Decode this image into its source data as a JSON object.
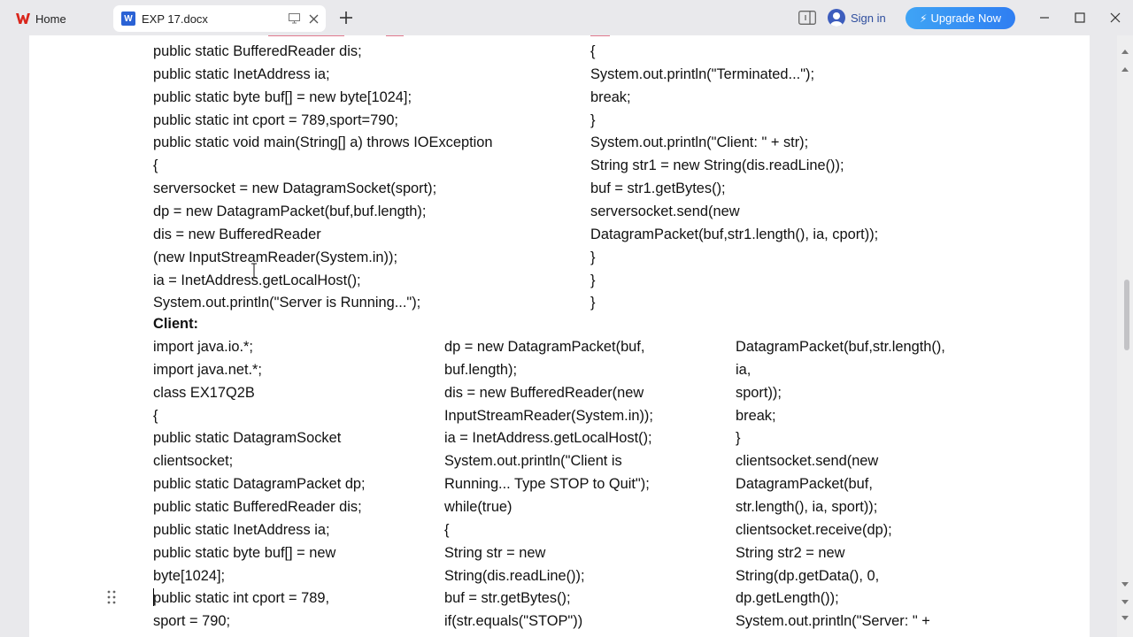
{
  "titlebar": {
    "home_tab_label": "Home",
    "doc_tab_title": "EXP 17.docx",
    "doc_logo_letter": "W",
    "signin_label": "Sign in",
    "upgrade_label": "Upgrade Now",
    "brand_color": "#d9261c",
    "upgrade_color": "#2f7ef2"
  },
  "icons": {
    "home": "wps-logo-icon",
    "doc": "word-doc-icon",
    "monitor": "monitor-icon",
    "close_tab": "close-icon",
    "new_tab": "plus-icon",
    "layout": "layout-icon",
    "user": "user-icon",
    "bolt": "bolt-icon",
    "minimize": "minimize-icon",
    "maximize": "maximize-icon",
    "close_window": "close-window-icon"
  },
  "document": {
    "server_left": [
      "public static BufferedReader dis;",
      "public static InetAddress ia;",
      "public static byte buf[] = new byte[1024];",
      "public static int cport = 789,sport=790;",
      "public static void main(String[] a) throws IOException",
      "{",
      "serversocket = new DatagramSocket(sport);",
      "dp = new DatagramPacket(buf,buf.length);",
      "dis = new BufferedReader",
      "(new InputStreamReader(System.in));",
      "ia = InetAddress.getLocalHost();",
      "System.out.println(\"Server is Running...\");"
    ],
    "server_right": [
      "{",
      "System.out.println(\"Terminated...\");",
      "break;",
      "}",
      "System.out.println(\"Client: \" + str);",
      "String str1 = new String(dis.readLine());",
      "buf = str1.getBytes();",
      "serversocket.send(new",
      "DatagramPacket(buf,str1.length(), ia, cport));",
      "}",
      "}",
      "}"
    ],
    "client_heading": "Client:",
    "client_col1": [
      "import java.io.*;",
      "import java.net.*;",
      "class EX17Q2B",
      "{",
      "public static DatagramSocket",
      "clientsocket;",
      "public static DatagramPacket dp;",
      "public static BufferedReader dis;",
      "public static InetAddress ia;",
      "public static byte buf[] = new",
      "byte[1024];",
      "public static int cport = 789,",
      "sport = 790;"
    ],
    "client_col2": [
      "dp = new DatagramPacket(buf,",
      "buf.length);",
      "dis = new BufferedReader(new",
      "InputStreamReader(System.in));",
      "ia = InetAddress.getLocalHost();",
      "System.out.println(\"Client is",
      "Running... Type STOP to Quit\");",
      "while(true)",
      "{",
      "String str = new",
      "String(dis.readLine());",
      "buf = str.getBytes();",
      "if(str.equals(\"STOP\"))"
    ],
    "client_col3": [
      "DatagramPacket(buf,str.length(),",
      "ia,",
      "sport));",
      "break;",
      "}",
      "clientsocket.send(new",
      "DatagramPacket(buf,",
      "str.length(), ia, sport));",
      "clientsocket.receive(dp);",
      "String str2 = new",
      "String(dp.getData(), 0,",
      "dp.getLength());",
      "System.out.println(\"Server: \" +"
    ]
  }
}
